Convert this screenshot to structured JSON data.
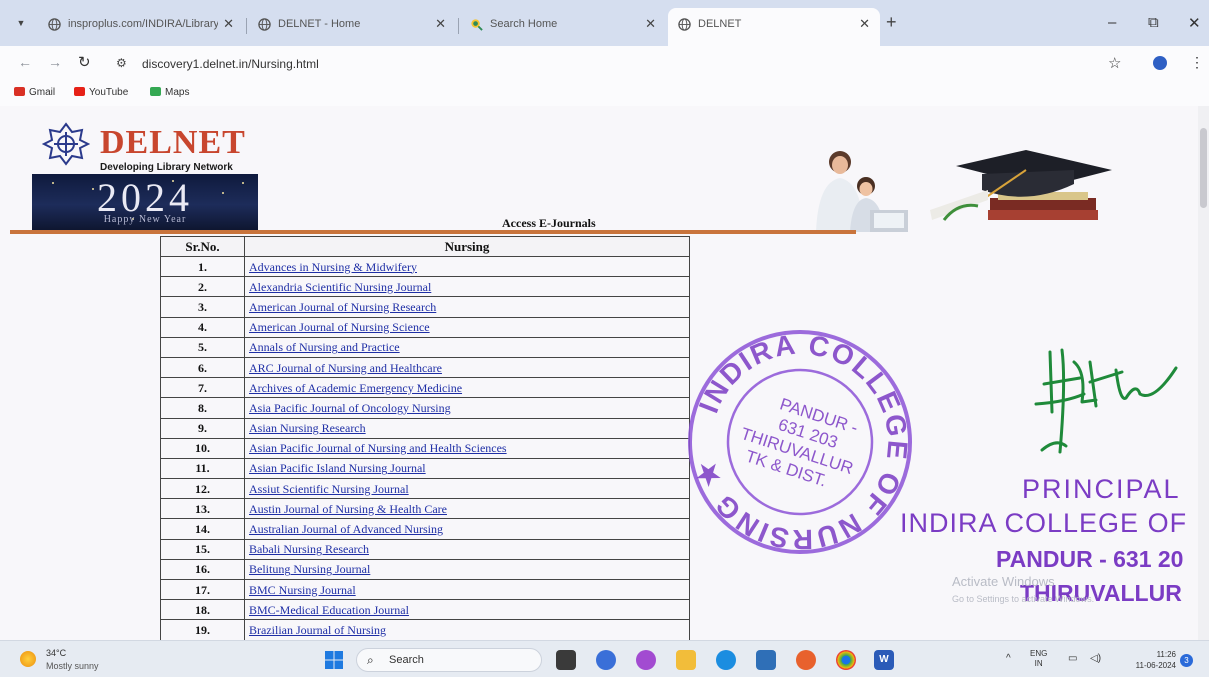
{
  "browser": {
    "tabs": [
      {
        "label": "insproplus.com/INDIRA/Library",
        "active": false
      },
      {
        "label": "DELNET - Home",
        "active": false
      },
      {
        "label": "Search Home",
        "active": false
      },
      {
        "label": "DELNET",
        "active": true
      }
    ],
    "url": "discovery1.delnet.in/Nursing.html",
    "bookmarks": [
      {
        "label": "Gmail",
        "color": "#d93025"
      },
      {
        "label": "YouTube",
        "color": "#e62117"
      },
      {
        "label": "Maps",
        "color": "#34a853"
      }
    ]
  },
  "site": {
    "logo_text": "DELNET",
    "tagline": "Developing Library Network",
    "banner_year": "2024",
    "banner_sub": "Happy New Year",
    "section_title": "Access E-Journals"
  },
  "table": {
    "headers": [
      "Sr.No.",
      "Nursing"
    ],
    "rows": [
      {
        "no": "1.",
        "name": "Advances in Nursing & Midwifery"
      },
      {
        "no": "2.",
        "name": "Alexandria Scientific Nursing Journal"
      },
      {
        "no": "3.",
        "name": "American Journal of Nursing Research"
      },
      {
        "no": "4.",
        "name": "American Journal of Nursing Science"
      },
      {
        "no": "5.",
        "name": "Annals of Nursing and Practice"
      },
      {
        "no": "6.",
        "name": "ARC Journal of Nursing and Healthcare"
      },
      {
        "no": "7.",
        "name": "Archives of Academic Emergency Medicine"
      },
      {
        "no": "8.",
        "name": "Asia Pacific Journal of Oncology Nursing"
      },
      {
        "no": "9.",
        "name": "Asian Nursing Research"
      },
      {
        "no": "10.",
        "name": "Asian Pacific Journal of Nursing and Health Sciences"
      },
      {
        "no": "11.",
        "name": "Asian Pacific Island Nursing Journal"
      },
      {
        "no": "12.",
        "name": "Assiut Scientific Nursing Journal"
      },
      {
        "no": "13.",
        "name": "Austin Journal of Nursing & Health Care"
      },
      {
        "no": "14.",
        "name": "Australian Journal of Advanced Nursing"
      },
      {
        "no": "15.",
        "name": "Babali Nursing Research"
      },
      {
        "no": "16.",
        "name": "Belitung Nursing Journal"
      },
      {
        "no": "17.",
        "name": "BMC Nursing Journal"
      },
      {
        "no": "18.",
        "name": "BMC-Medical Education Journal"
      },
      {
        "no": "19.",
        "name": "Brazilian Journal of Nursing"
      }
    ]
  },
  "stamp": {
    "ring_text": "INDIRA COLLEGE OF NURSING",
    "center_lines": [
      "PANDUR -",
      "631 203",
      "THIRUVALLUR",
      "TK & DIST."
    ]
  },
  "principal_seal": {
    "lines": [
      "PRINCIPAL",
      "INDIRA COLLEGE OF",
      "PANDUR - 631 20",
      "THIRUVALLUR"
    ]
  },
  "watermark": {
    "line1": "Activate Windows",
    "line2": "Go to Settings to activate Windows."
  },
  "taskbar": {
    "temp": "34°C",
    "weather": "Mostly sunny",
    "search_label": "Search",
    "lang_line1": "ENG",
    "lang_line2": "IN",
    "time": "11:26",
    "date": "11-06-2024",
    "notification_count": "3"
  },
  "colors": {
    "link": "#1f2fa6",
    "delnet_red": "#c8462e",
    "rule_orange": "#c9743c",
    "stamp_purple": "#7b3cc4",
    "signature_green": "#1f8a3a"
  }
}
